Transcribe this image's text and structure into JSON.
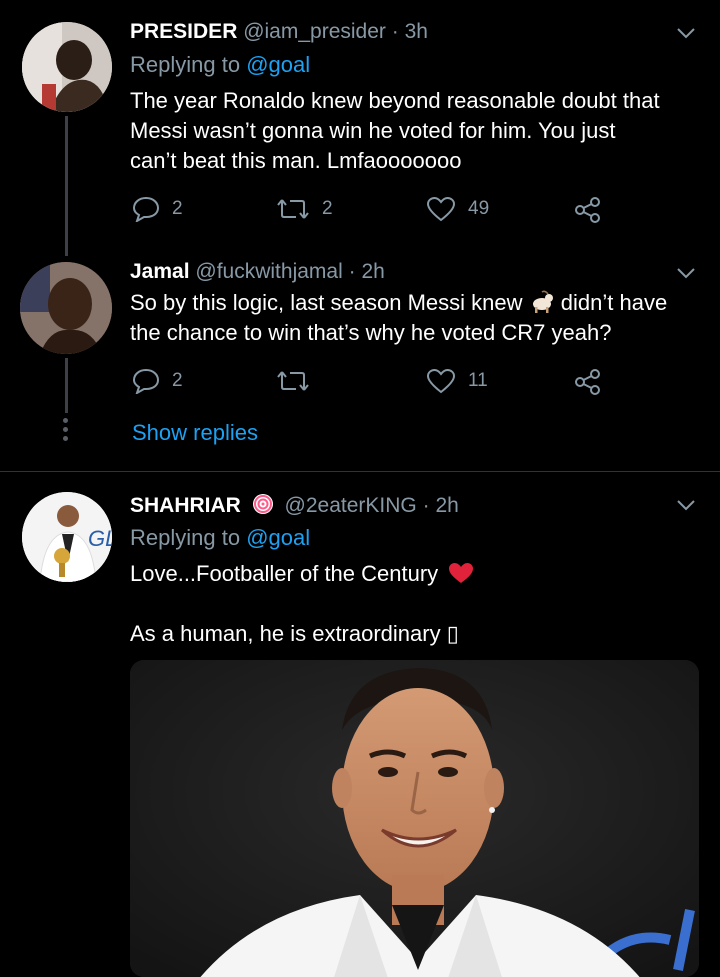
{
  "tweets": [
    {
      "name": "PRESIDER",
      "handle": "@iam_presider",
      "time": "3h",
      "replying_label": "Replying to",
      "replying_to": "@goal",
      "lines": [
        "The year Ronaldo knew beyond reasonable doubt that",
        "Messi wasn’t gonna win he voted for him. You just",
        "can’t beat this man. Lmfaooooooo"
      ],
      "replies": "2",
      "retweets": "2",
      "likes": "49"
    },
    {
      "name": "Jamal",
      "handle": "@fuckwithjamal",
      "time": "2h",
      "line1_before": "So by this logic, last season Messi knew",
      "emoji": "goat-emoji",
      "line1_after": "didn’t have",
      "line2": "the chance to win that’s why he voted CR7 yeah?",
      "replies": "2",
      "retweets": "",
      "likes": "11"
    },
    {
      "name": "SHAHRIAR",
      "badge": "lollipop-emoji",
      "handle": "@2eaterKING",
      "time": "2h",
      "replying_label": "Replying to",
      "replying_to": "@goal",
      "line1": "Love...Footballer of the Century",
      "heart_emoji": "red-heart-emoji",
      "line2": "As a human, he is extraordinary",
      "line2_glyph": "▯"
    }
  ],
  "show_replies": "Show replies",
  "separator": "·",
  "colors": {
    "background": "#000000",
    "muted": "#8899a6",
    "link": "#1da1f2",
    "divider": "#2f3336",
    "thread_line": "#3d4147"
  }
}
